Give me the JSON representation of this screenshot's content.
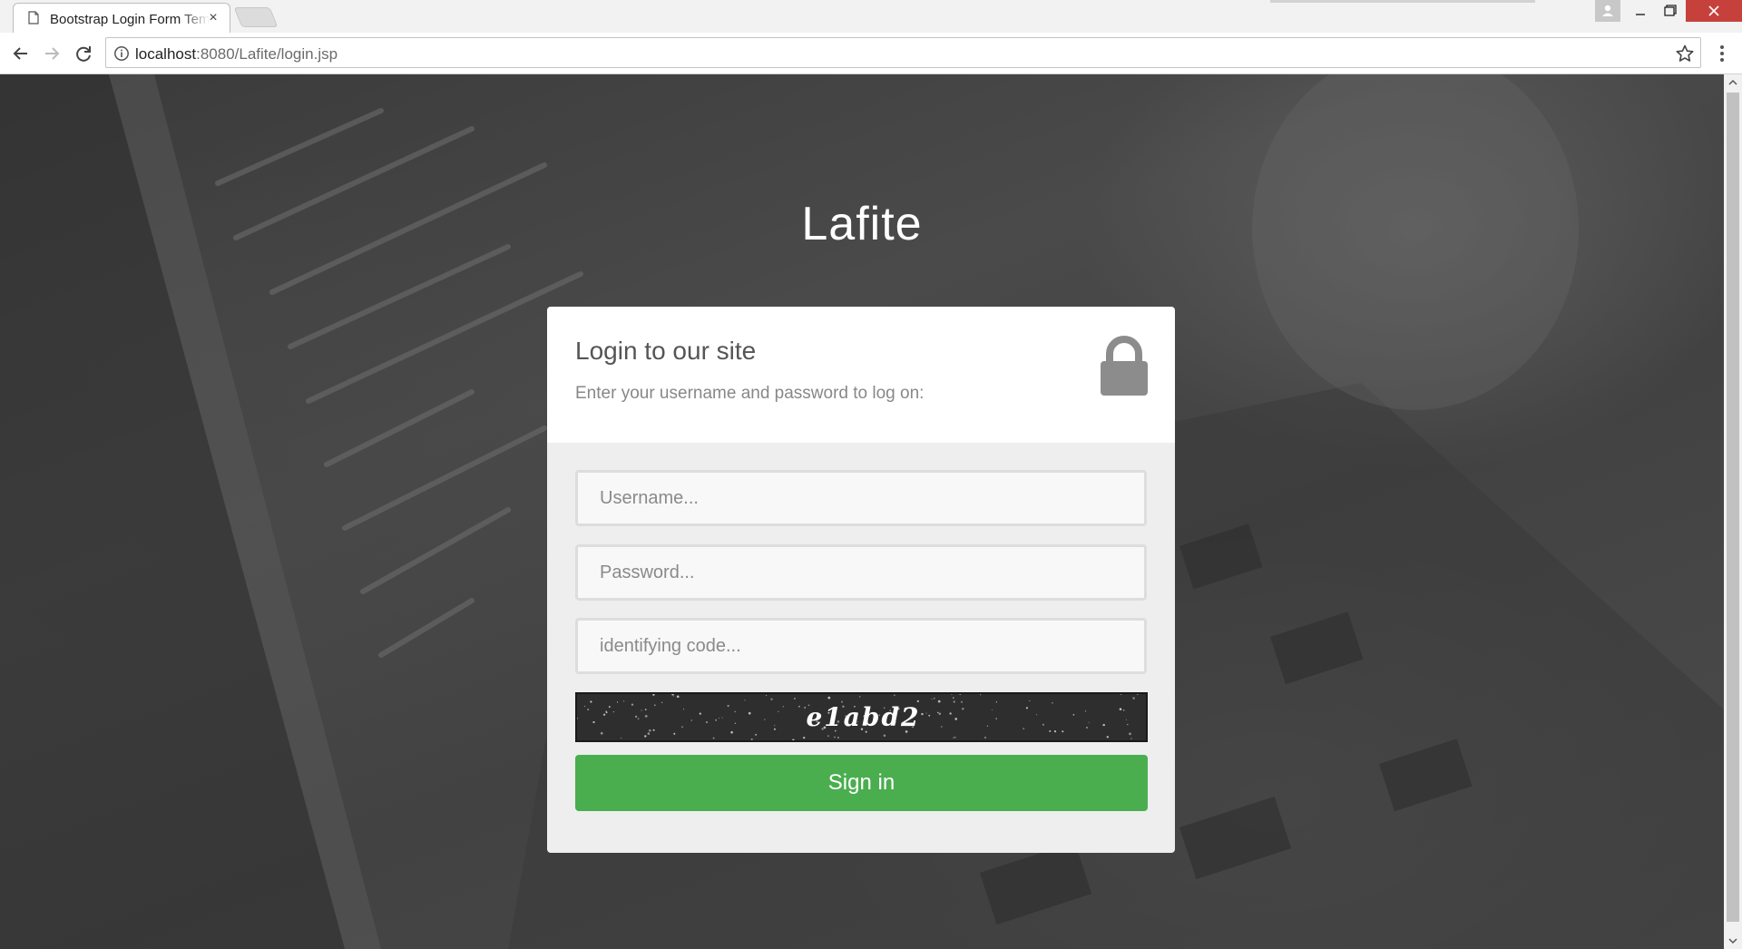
{
  "browser": {
    "tab_title": "Bootstrap Login Form Template",
    "url_host": "localhost",
    "url_path": ":8080/Lafite/login.jsp"
  },
  "page": {
    "site_title": "Lafite",
    "form": {
      "heading": "Login to our site",
      "subheading": "Enter your username and password to log on:",
      "username_placeholder": "Username...",
      "password_placeholder": "Password...",
      "code_placeholder": "identifying code...",
      "captcha_text": "e1abd2",
      "signin_label": "Sign in"
    }
  },
  "colors": {
    "signin_button": "#4aae4f",
    "close_button": "#c7413c"
  },
  "icons": [
    "page-icon",
    "tab-close-icon",
    "back-icon",
    "forward-icon",
    "reload-icon",
    "info-icon",
    "star-icon",
    "menu-icon",
    "lock-icon"
  ]
}
